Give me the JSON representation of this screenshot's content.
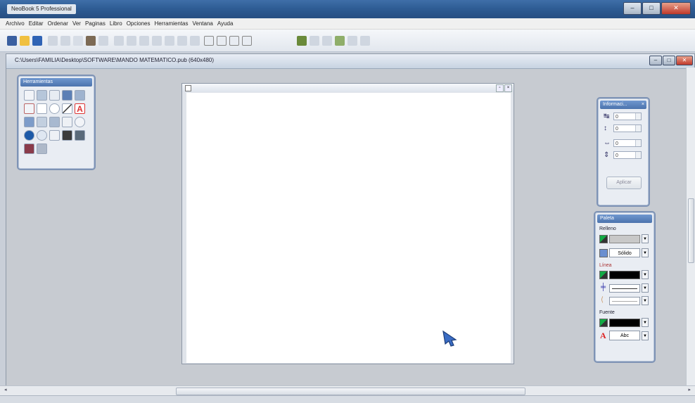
{
  "window": {
    "title": "NeoBook 5 Professional"
  },
  "menu": [
    "Archivo",
    "Editar",
    "Ordenar",
    "Ver",
    "Paginas",
    "Libro",
    "Opciones",
    "Herramientas",
    "Ventana",
    "Ayuda"
  ],
  "document": {
    "path": "C:\\Users\\FAMILIA\\Desktop\\SOFTWARE\\MANDO MATEMATICO.pub (640x480)"
  },
  "tools_panel": {
    "title": "Herramientas"
  },
  "info_panel": {
    "title": "Informaci...",
    "fields": [
      {
        "value": "0"
      },
      {
        "value": "0"
      },
      {
        "value": "0"
      },
      {
        "value": "0"
      }
    ],
    "apply_label": "Aplicar"
  },
  "palette_panel": {
    "title": "Paleta",
    "relleno_label": "Relleno",
    "fill_style": "Sólido",
    "linea_label": "Línea",
    "fuente_label": "Fuente",
    "font_sample": "Abc"
  },
  "colors": {
    "fill": "#c8c8c8",
    "line": "#000000",
    "font": "#000000",
    "accent": "#4c73ad"
  }
}
